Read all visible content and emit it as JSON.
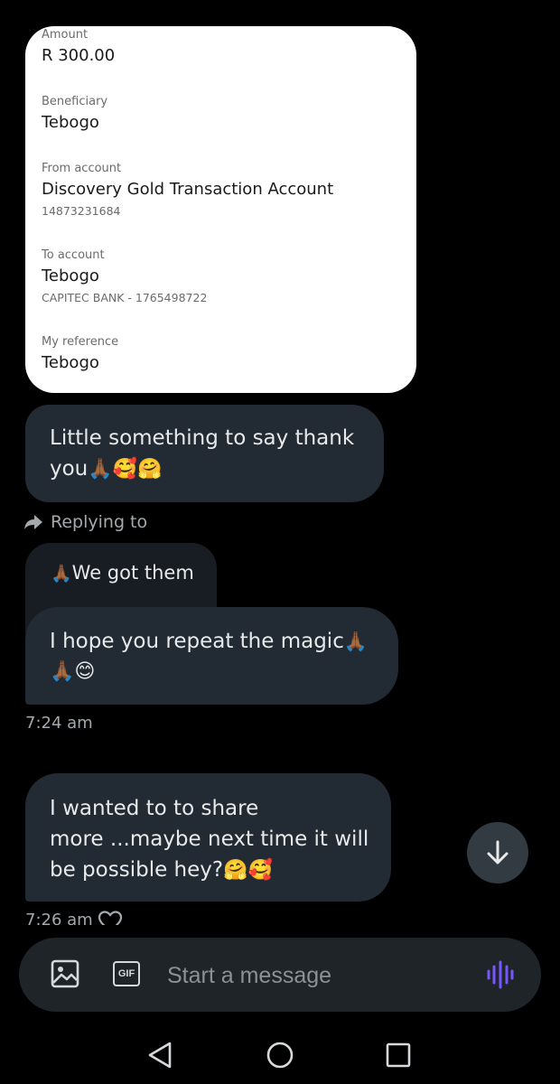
{
  "receipt": {
    "amount_label": "Amount",
    "amount_value": "R 300.00",
    "beneficiary_label": "Beneficiary",
    "beneficiary_value": "Tebogo",
    "from_label": "From account",
    "from_value": "Discovery Gold Transaction Account",
    "from_number": "14873231684",
    "to_label": "To account",
    "to_value": "Tebogo",
    "to_bank": "CAPITEC BANK - 1765498722",
    "reference_label": "My reference",
    "reference_value": "Tebogo"
  },
  "messages": {
    "thanks": {
      "line1": "Little something to say thank",
      "line2_text": "you",
      "line2_emoji": "🙏🏾🥰🤗"
    },
    "reply_indicator": "Replying to",
    "quoted": {
      "emoji": "🙏🏾",
      "text": "We got them"
    },
    "magic": {
      "line1_text": "I hope you repeat the magic",
      "line1_emoji": "🙏🏾",
      "line2_emoji": "🙏🏾😊"
    },
    "time1": "7:24 am",
    "share": {
      "line1": "I wanted to to share",
      "line2": "more ...maybe next time it will",
      "line3_text": "be possible hey?",
      "line3_emoji": "🤗🥰"
    },
    "time2": "7:26 am"
  },
  "composer": {
    "placeholder": "Start a message",
    "gif_label": "GIF"
  },
  "icons": {
    "media": "image-icon",
    "gif": "gif-icon",
    "voice": "voice-wave-icon",
    "scroll": "arrow-down-icon",
    "reply": "reply-arrow-icon",
    "heart": "heart-outline-icon",
    "nav_back": "triangle-back-icon",
    "nav_home": "circle-home-icon",
    "nav_recents": "square-recents-icon"
  },
  "colors": {
    "background": "#000000",
    "bubble": "#222b33",
    "receipt_card": "#ffffff",
    "accent_voice": "#7856ff"
  }
}
